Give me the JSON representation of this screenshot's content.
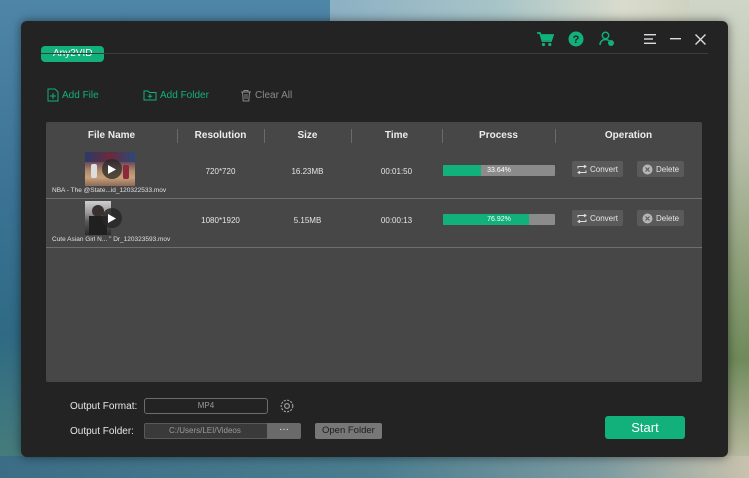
{
  "app": {
    "name": "Any2VID",
    "accent_color": "#12b07a"
  },
  "titlebar": {
    "icons": [
      "cart-icon",
      "help-icon",
      "account-icon",
      "menu-icon",
      "minimize-icon",
      "close-icon"
    ]
  },
  "toolbar": {
    "add_file": "Add File",
    "add_folder": "Add Folder",
    "clear_all": "Clear All"
  },
  "table": {
    "columns": [
      "File Name",
      "Resolution",
      "Size",
      "Time",
      "Process",
      "Operation"
    ],
    "rows": [
      {
        "file_name": "NBA - The @State...id_120322533.mov",
        "resolution": "720*720",
        "size": "16.23MB",
        "time": "00:01:50",
        "progress_text": "33.64%",
        "progress": 33.64,
        "convert": "Convert",
        "delete": "Delete"
      },
      {
        "file_name": "Cute Asian Girl N... \" Dr_120323593.mov",
        "resolution": "1080*1920",
        "size": "5.15MB",
        "time": "00:00:13",
        "progress_text": "76.92%",
        "progress": 76.92,
        "convert": "Convert",
        "delete": "Delete"
      }
    ]
  },
  "output": {
    "format_label": "Output Format:",
    "format_value": "MP4",
    "folder_label": "Output Folder:",
    "folder_value": "C:/Users/LEI/Videos",
    "browse_label": "···",
    "open_folder": "Open Folder"
  },
  "start_button": "Start"
}
